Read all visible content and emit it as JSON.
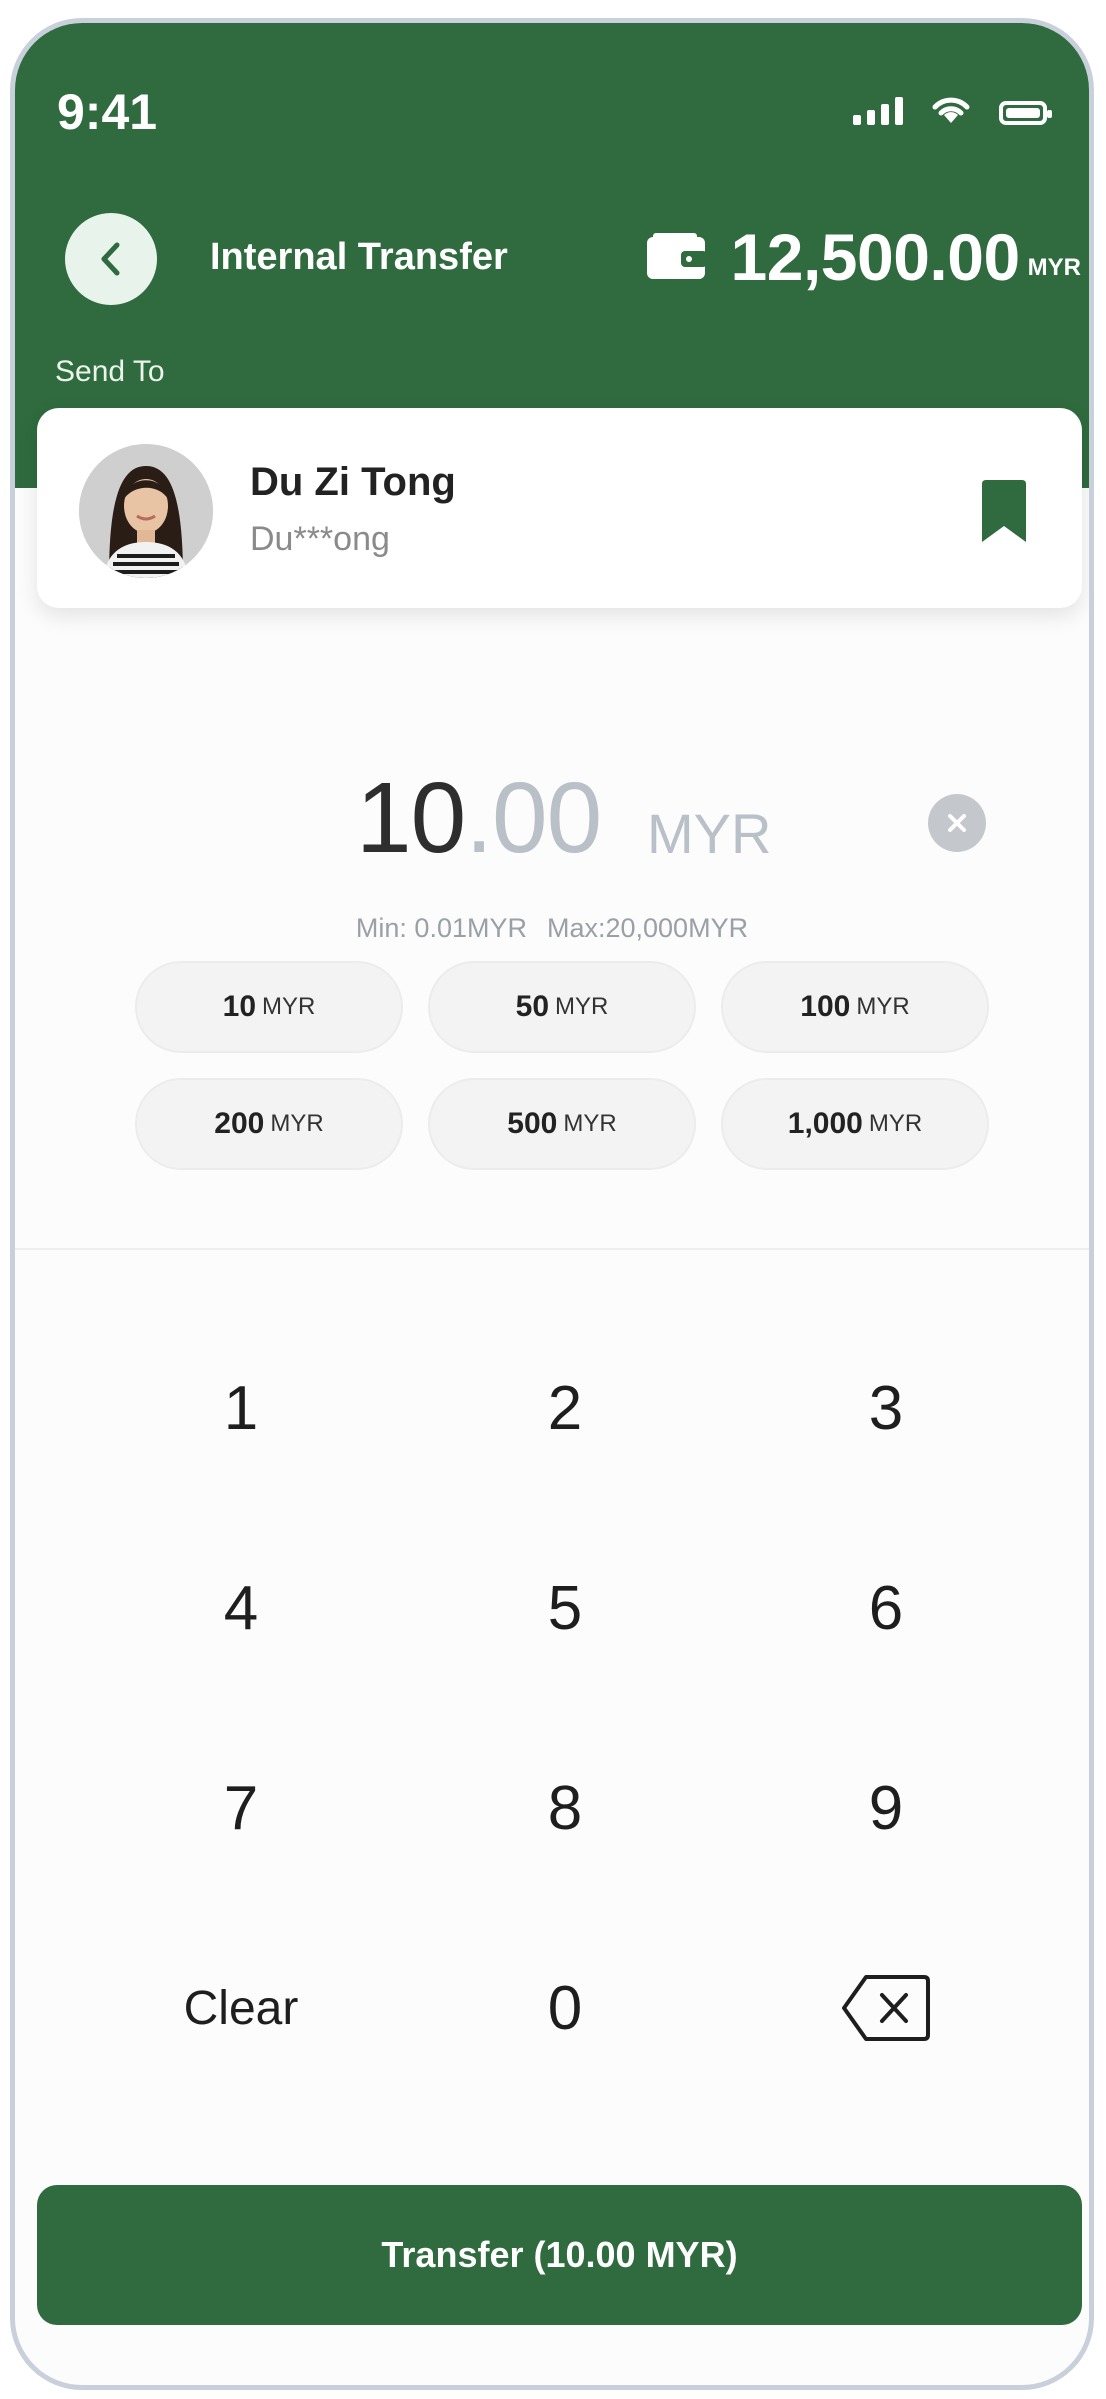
{
  "status_bar": {
    "time": "9:41"
  },
  "header": {
    "title": "Internal Transfer",
    "balance_amount": "12,500.00",
    "balance_currency": "MYR",
    "send_to_label": "Send To"
  },
  "recipient": {
    "name": "Du Zi Tong",
    "account": "Du***ong"
  },
  "amount": {
    "whole": "10",
    "decimal": ".00",
    "currency": "MYR",
    "min_label": "Min: 0.01MYR",
    "max_label": "Max:20,000MYR"
  },
  "quick_amounts": [
    {
      "value": "10",
      "currency": "MYR"
    },
    {
      "value": "50",
      "currency": "MYR"
    },
    {
      "value": "100",
      "currency": "MYR"
    },
    {
      "value": "200",
      "currency": "MYR"
    },
    {
      "value": "500",
      "currency": "MYR"
    },
    {
      "value": "1,000",
      "currency": "MYR"
    }
  ],
  "keypad": {
    "k1": "1",
    "k2": "2",
    "k3": "3",
    "k4": "4",
    "k5": "5",
    "k6": "6",
    "k7": "7",
    "k8": "8",
    "k9": "9",
    "clear": "Clear",
    "k0": "0"
  },
  "transfer_button": "Transfer (10.00 MYR)",
  "colors": {
    "brand_green": "#2f6b3e",
    "chip_bg": "#f3f3f3"
  },
  "icons": [
    "back-chevron-icon",
    "wallet-icon",
    "bookmark-icon",
    "clear-circle-icon",
    "backspace-icon",
    "signal-icon",
    "wifi-icon",
    "battery-icon"
  ]
}
